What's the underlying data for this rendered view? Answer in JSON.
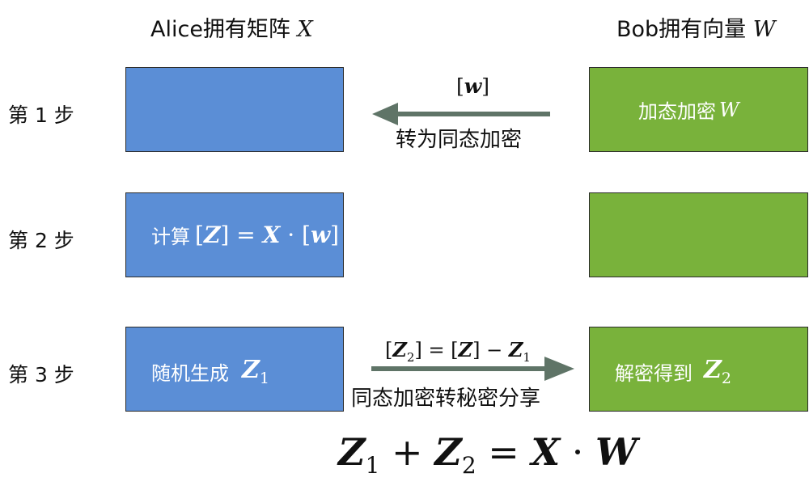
{
  "headers": {
    "alice": "Alice拥有矩阵 ",
    "alice_var": "X",
    "bob": "Bob拥有向量 ",
    "bob_var": "W"
  },
  "steps": [
    {
      "label": "第 1 步"
    },
    {
      "label": "第 2 步"
    },
    {
      "label": "第 3 步"
    }
  ],
  "boxes": {
    "step1_right": {
      "text": "加态加密 ",
      "var": "W"
    },
    "step2_left": {
      "text": "计算 "
    },
    "step3_left": {
      "text": "随机生成 "
    },
    "step3_right": {
      "text": "解密得到 "
    }
  },
  "arrows": {
    "step1": {
      "label": "转为同态加密",
      "formula": "[w]"
    },
    "step3": {
      "label": "同态加密转秘密分享",
      "formula": "[Z2] = [Z] − Z1"
    }
  },
  "final_formula": "Z1 + Z2 = X · W",
  "colors": {
    "blue": "#5b8ed6",
    "green": "#79b23b",
    "arrow": "#5f7467"
  }
}
